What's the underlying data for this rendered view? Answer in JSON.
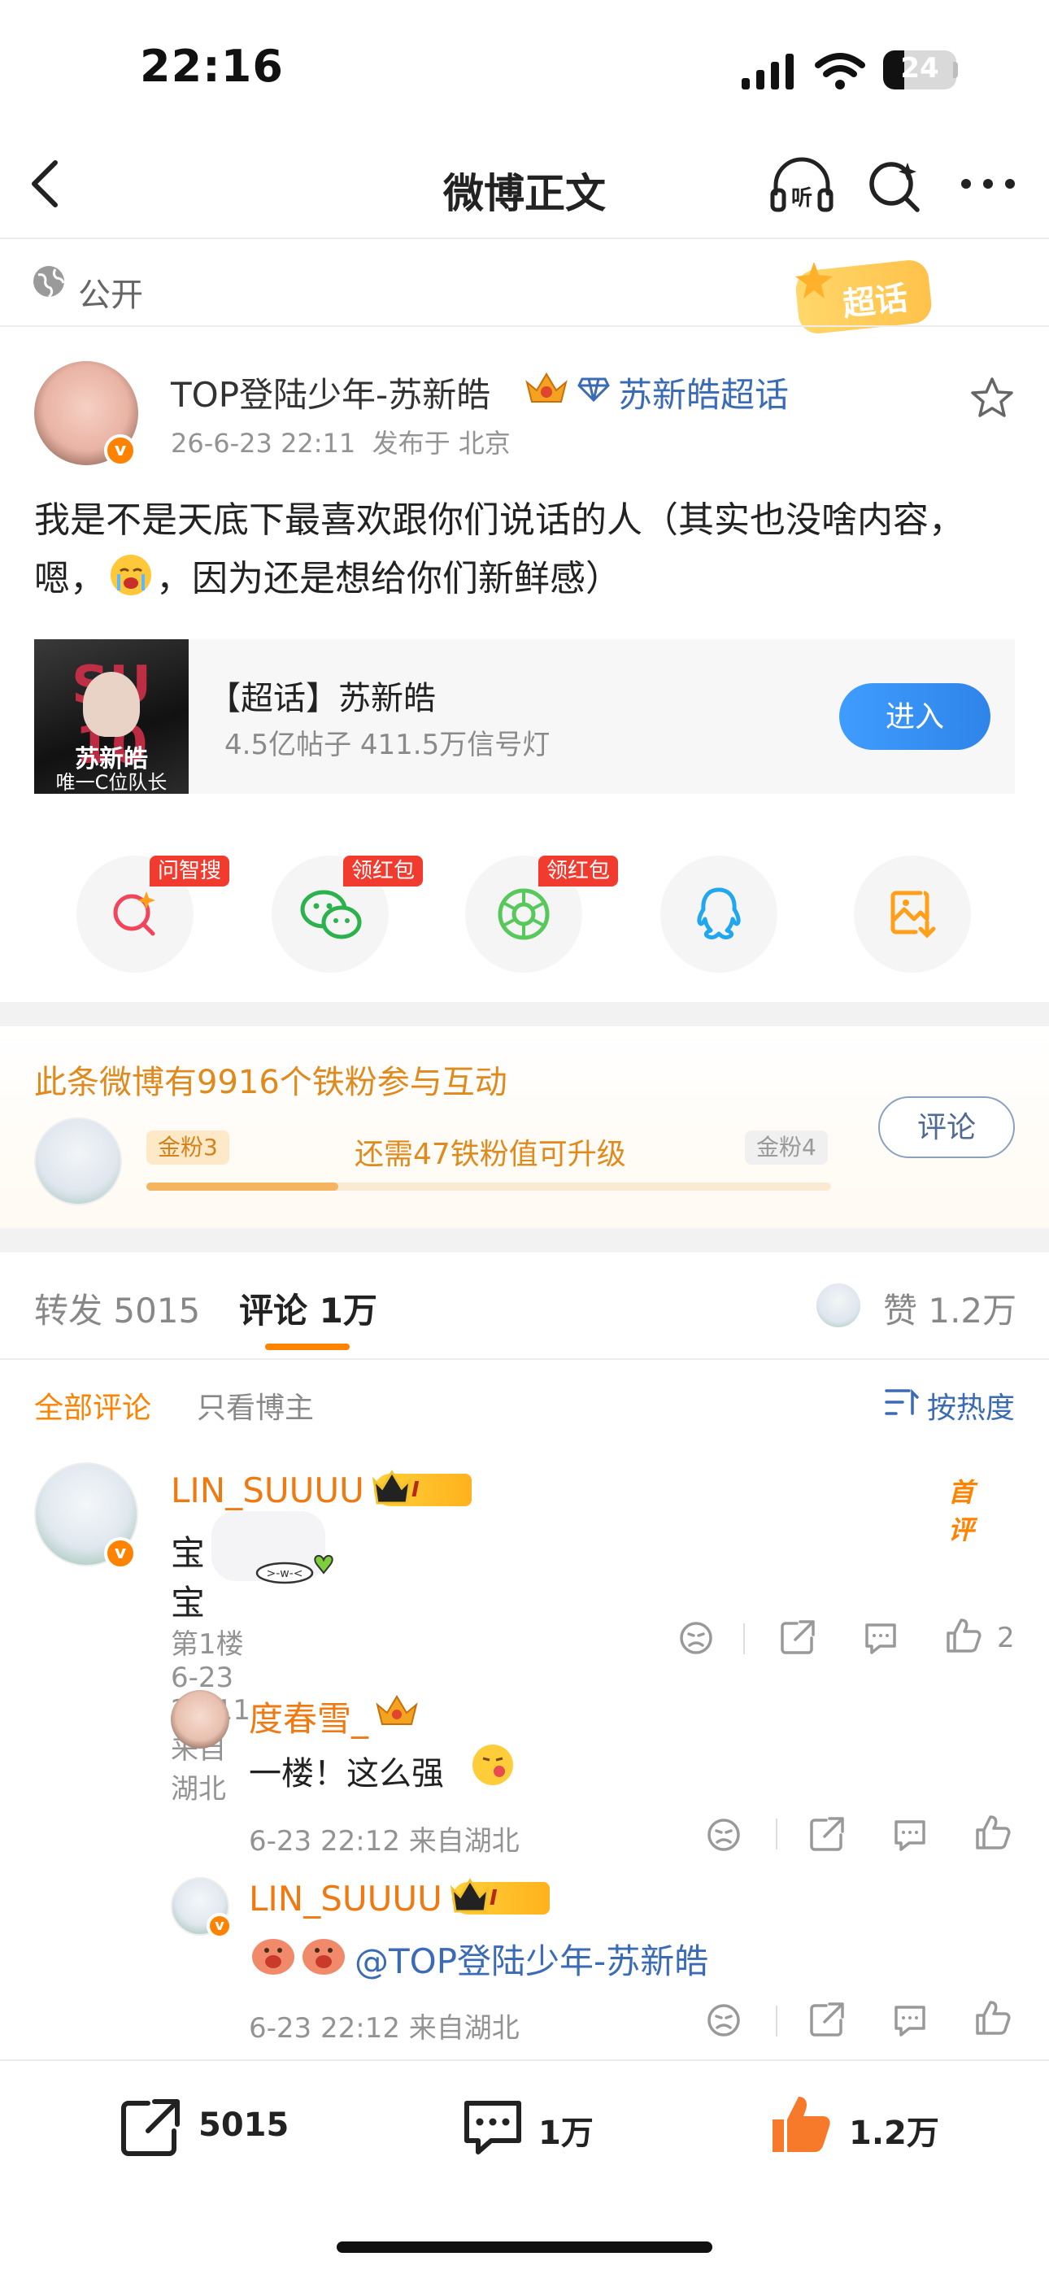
{
  "status_bar": {
    "time": "22:16",
    "battery": "24"
  },
  "nav": {
    "title": "微博正文"
  },
  "visibility": {
    "label": "公开"
  },
  "super_topic_badge": "超话",
  "post": {
    "author_name": "TOP登陆少年-苏新皓",
    "super_topic_link": "苏新皓超话",
    "timestamp": "26-6-23 22:11",
    "location": "发布于 北京",
    "text_part1": "我是不是天底下最喜欢跟你们说话的人（其实也没啥内容，嗯，",
    "text_part2": "，因为还是想给你们新鲜感）"
  },
  "topic_card": {
    "title": "【超话】苏新皓",
    "stats": "4.5亿帖子 411.5万信号灯",
    "enter_label": "进入",
    "cover_text_top": "SU 10",
    "cover_text_name": "苏新皓",
    "cover_text_sub": "唯一C位队长"
  },
  "share": {
    "items": [
      {
        "name": "search",
        "tag": "问智搜"
      },
      {
        "name": "wechat",
        "tag": "领红包"
      },
      {
        "name": "moments",
        "tag": "领红包"
      },
      {
        "name": "qq",
        "tag": ""
      },
      {
        "name": "save-image",
        "tag": ""
      }
    ]
  },
  "fans": {
    "title": "此条微博有9916个铁粉参与互动",
    "current_level": "金粉3",
    "next_level": "金粉4",
    "progress_text": "还需47铁粉值可升级",
    "progress_fraction": 0.28,
    "comment_button": "评论"
  },
  "tabs": {
    "repost": "转发 5015",
    "comment": "评论 1万",
    "like": "赞 1.2万"
  },
  "filters": {
    "all": "全部评论",
    "owner_only": "只看博主",
    "sort": "按热度"
  },
  "comments": [
    {
      "user": "LIN_SUUUU",
      "vip_level": "I",
      "badge": "首评",
      "text": "宝宝",
      "meta": "第1楼 6-23 22:11 来自湖北",
      "likes": "2",
      "replies": [
        {
          "user": "度春雪_",
          "text": "一楼！这么强",
          "meta": "6-23 22:12 来自湖北"
        },
        {
          "user": "LIN_SUUUU",
          "vip_level": "I",
          "text": "@TOP登陆少年-苏新皓",
          "meta": "6-23 22:12 来自湖北"
        }
      ]
    }
  ],
  "bottom_bar": {
    "repost_count": "5015",
    "comment_count": "1万",
    "like_count": "1.2万"
  },
  "colors": {
    "accent": "#ff8200",
    "link": "#3b6bb5",
    "enter_button": "#2f84e8",
    "tag_red": "#f23b2f"
  }
}
